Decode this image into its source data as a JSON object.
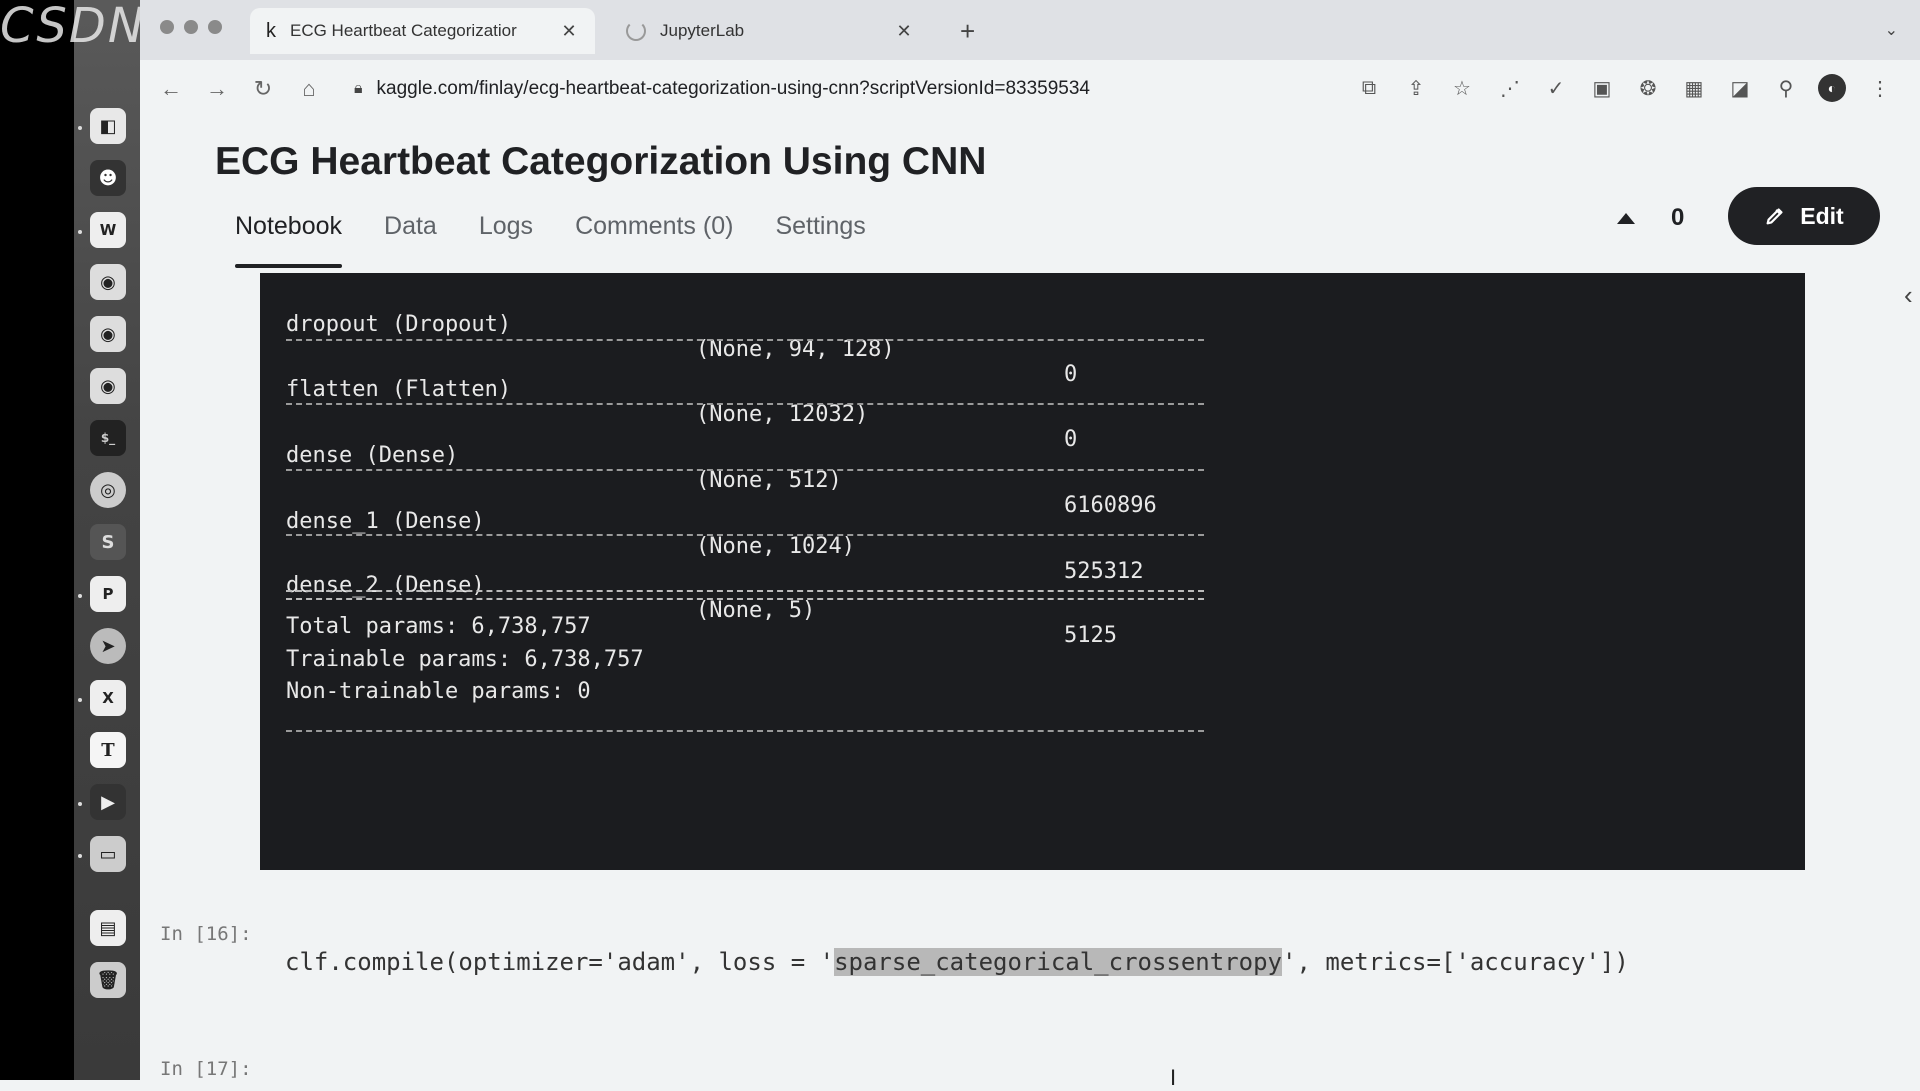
{
  "watermark": "CSDN @上班",
  "browser": {
    "tabs": [
      {
        "label": "ECG Heartbeat Categorizatior",
        "favicon": "k"
      },
      {
        "label": "JupyterLab",
        "favicon": "spinner"
      }
    ],
    "new_tab": "+",
    "url": "kaggle.com/finlay/ecg-heartbeat-categorization-using-cnn?scriptVersionId=83359534"
  },
  "notebook": {
    "title": "ECG Heartbeat Categorization Using CNN",
    "tabs": [
      "Notebook",
      "Data",
      "Logs",
      "Comments (0)",
      "Settings"
    ],
    "active_tab": "Notebook",
    "votes": "0",
    "edit_label": "Edit"
  },
  "output": {
    "rows": [
      {
        "layer": "dropout (Dropout)",
        "shape": "(None, 94, 128)",
        "params": "0"
      },
      {
        "layer": "flatten (Flatten)",
        "shape": "(None, 12032)",
        "params": "0"
      },
      {
        "layer": "dense (Dense)",
        "shape": "(None, 512)",
        "params": "6160896"
      },
      {
        "layer": "dense_1 (Dense)",
        "shape": "(None, 1024)",
        "params": "525312"
      },
      {
        "layer": "dense_2 (Dense)",
        "shape": "(None, 5)",
        "params": "5125"
      }
    ],
    "total": "Total params: 6,738,757",
    "trainable": "Trainable params: 6,738,757",
    "non_trainable": "Non-trainable params: 0"
  },
  "cells": {
    "prompt_16": "In [16]:",
    "prompt_17": "In [17]:",
    "code_pre": "clf.compile(optimizer='adam', loss = '",
    "code_hl": "sparse_categorical_crossentropy",
    "code_post": "', metrics=['accuracy'])"
  }
}
